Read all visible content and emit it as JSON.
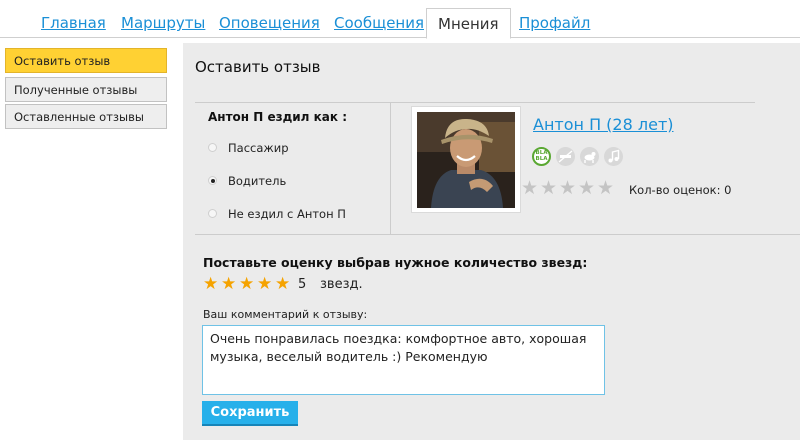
{
  "tabs": [
    {
      "label": "Главная",
      "active": false
    },
    {
      "label": "Маршруты",
      "active": false
    },
    {
      "label": "Оповещения",
      "active": false
    },
    {
      "label": "Сообщения",
      "active": false
    },
    {
      "label": "Мнения",
      "active": true
    },
    {
      "label": "Профайл",
      "active": false
    }
  ],
  "sidebar": {
    "items": [
      {
        "label": "Оставить отзыв",
        "active": true
      },
      {
        "label": "Полученные отзывы",
        "active": false
      },
      {
        "label": "Оставленные отзывы",
        "active": false
      }
    ]
  },
  "main": {
    "title": "Оставить отзыв",
    "role": {
      "title": "Антон П ездил как :",
      "options": [
        {
          "label": "Пассажир",
          "checked": false
        },
        {
          "label": "Водитель",
          "checked": true
        },
        {
          "label": "Не ездил с Антон П",
          "checked": false
        }
      ]
    },
    "user": {
      "name": "Антон П (28 лет)",
      "preference_icons": [
        "bla-bla-chat-icon",
        "no-smoking-icon",
        "no-pets-icon",
        "music-icon"
      ],
      "preference_badge_text": "BLA BLA",
      "rating_stars": 0,
      "rating_max": 5,
      "rating_count_text": "Кол-во оценок: 0"
    },
    "rate": {
      "title": "Поставьте оценку выбрав нужное количество звезд:",
      "value": 5,
      "max": 5,
      "value_text": "5",
      "unit": "звезд."
    },
    "comment": {
      "label": "Ваш комментарий к отзыву:",
      "value": "Очень понравилась поездка: комфортное авто, хорошая музыка, веселый водитель :) Рекомендую"
    },
    "save_label": "Сохранить"
  },
  "colors": {
    "link": "#1a8fd6",
    "active_menu": "#ffd133",
    "panel_bg": "#ebebeb",
    "star_active": "#f5a300",
    "star_inactive": "#c4c4c4",
    "button": "#27b0ea",
    "chat_icon_green": "#5aa832"
  }
}
